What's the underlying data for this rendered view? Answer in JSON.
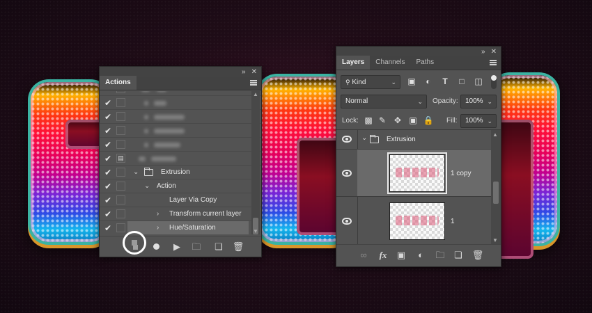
{
  "actions_panel": {
    "top_icons": [
      "collapse-icon",
      "close-icon"
    ],
    "tab": "Actions",
    "rows": [
      {
        "check": true,
        "dialog": false,
        "blurred": true
      },
      {
        "check": true,
        "dialog": false,
        "blurred": true
      },
      {
        "check": true,
        "dialog": false,
        "blurred": true
      },
      {
        "check": true,
        "dialog": false,
        "blurred": true
      },
      {
        "check": true,
        "dialog": false,
        "blurred": true
      },
      {
        "check": true,
        "dialog": true,
        "blurred": true
      },
      {
        "check": true,
        "dialog": false,
        "label": "Extrusion",
        "kind": "set"
      },
      {
        "check": true,
        "dialog": false,
        "label": "Action",
        "kind": "action"
      },
      {
        "check": true,
        "dialog": false,
        "label": "Layer Via Copy",
        "kind": "step"
      },
      {
        "check": true,
        "dialog": false,
        "label": "Transform current layer",
        "kind": "step"
      },
      {
        "check": true,
        "dialog": false,
        "label": "Hue/Saturation",
        "kind": "step",
        "highlighted": true
      }
    ],
    "footer_buttons": [
      "stop-icon",
      "record-icon",
      "play-icon",
      "folder-icon",
      "new-action-icon",
      "trash-icon"
    ]
  },
  "layers_panel": {
    "top_icons": [
      "collapse-icon",
      "close-icon"
    ],
    "tabs": [
      "Layers",
      "Channels",
      "Paths"
    ],
    "active_tab": "Layers",
    "filter": {
      "label": "Kind",
      "icons": [
        "image-filter-icon",
        "adjustment-filter-icon",
        "type-filter-icon",
        "shape-filter-icon",
        "smart-object-filter-icon"
      ]
    },
    "blend_mode": "Normal",
    "opacity_label": "Opacity:",
    "opacity_value": "100%",
    "lock_label": "Lock:",
    "lock_icons": [
      "lock-pixels-icon",
      "lock-image-icon",
      "lock-position-icon",
      "lock-artboard-icon",
      "lock-all-icon"
    ],
    "fill_label": "Fill:",
    "fill_value": "100%",
    "group": {
      "name": "Extrusion",
      "visible": true,
      "expanded": true
    },
    "layers": [
      {
        "name": "1 copy",
        "visible": true,
        "selected": true
      },
      {
        "name": "1",
        "visible": true,
        "selected": false
      }
    ],
    "footer_buttons": [
      "link-icon",
      "fx-icon",
      "mask-icon",
      "adjustment-icon",
      "group-folder-icon",
      "new-layer-icon",
      "trash-icon"
    ],
    "footer_fx": "fx"
  },
  "colors": {
    "panel_bg": "#535353",
    "tab_bg": "#424242",
    "selected_row": "#6a6a6a",
    "background": "#1f0c17"
  }
}
